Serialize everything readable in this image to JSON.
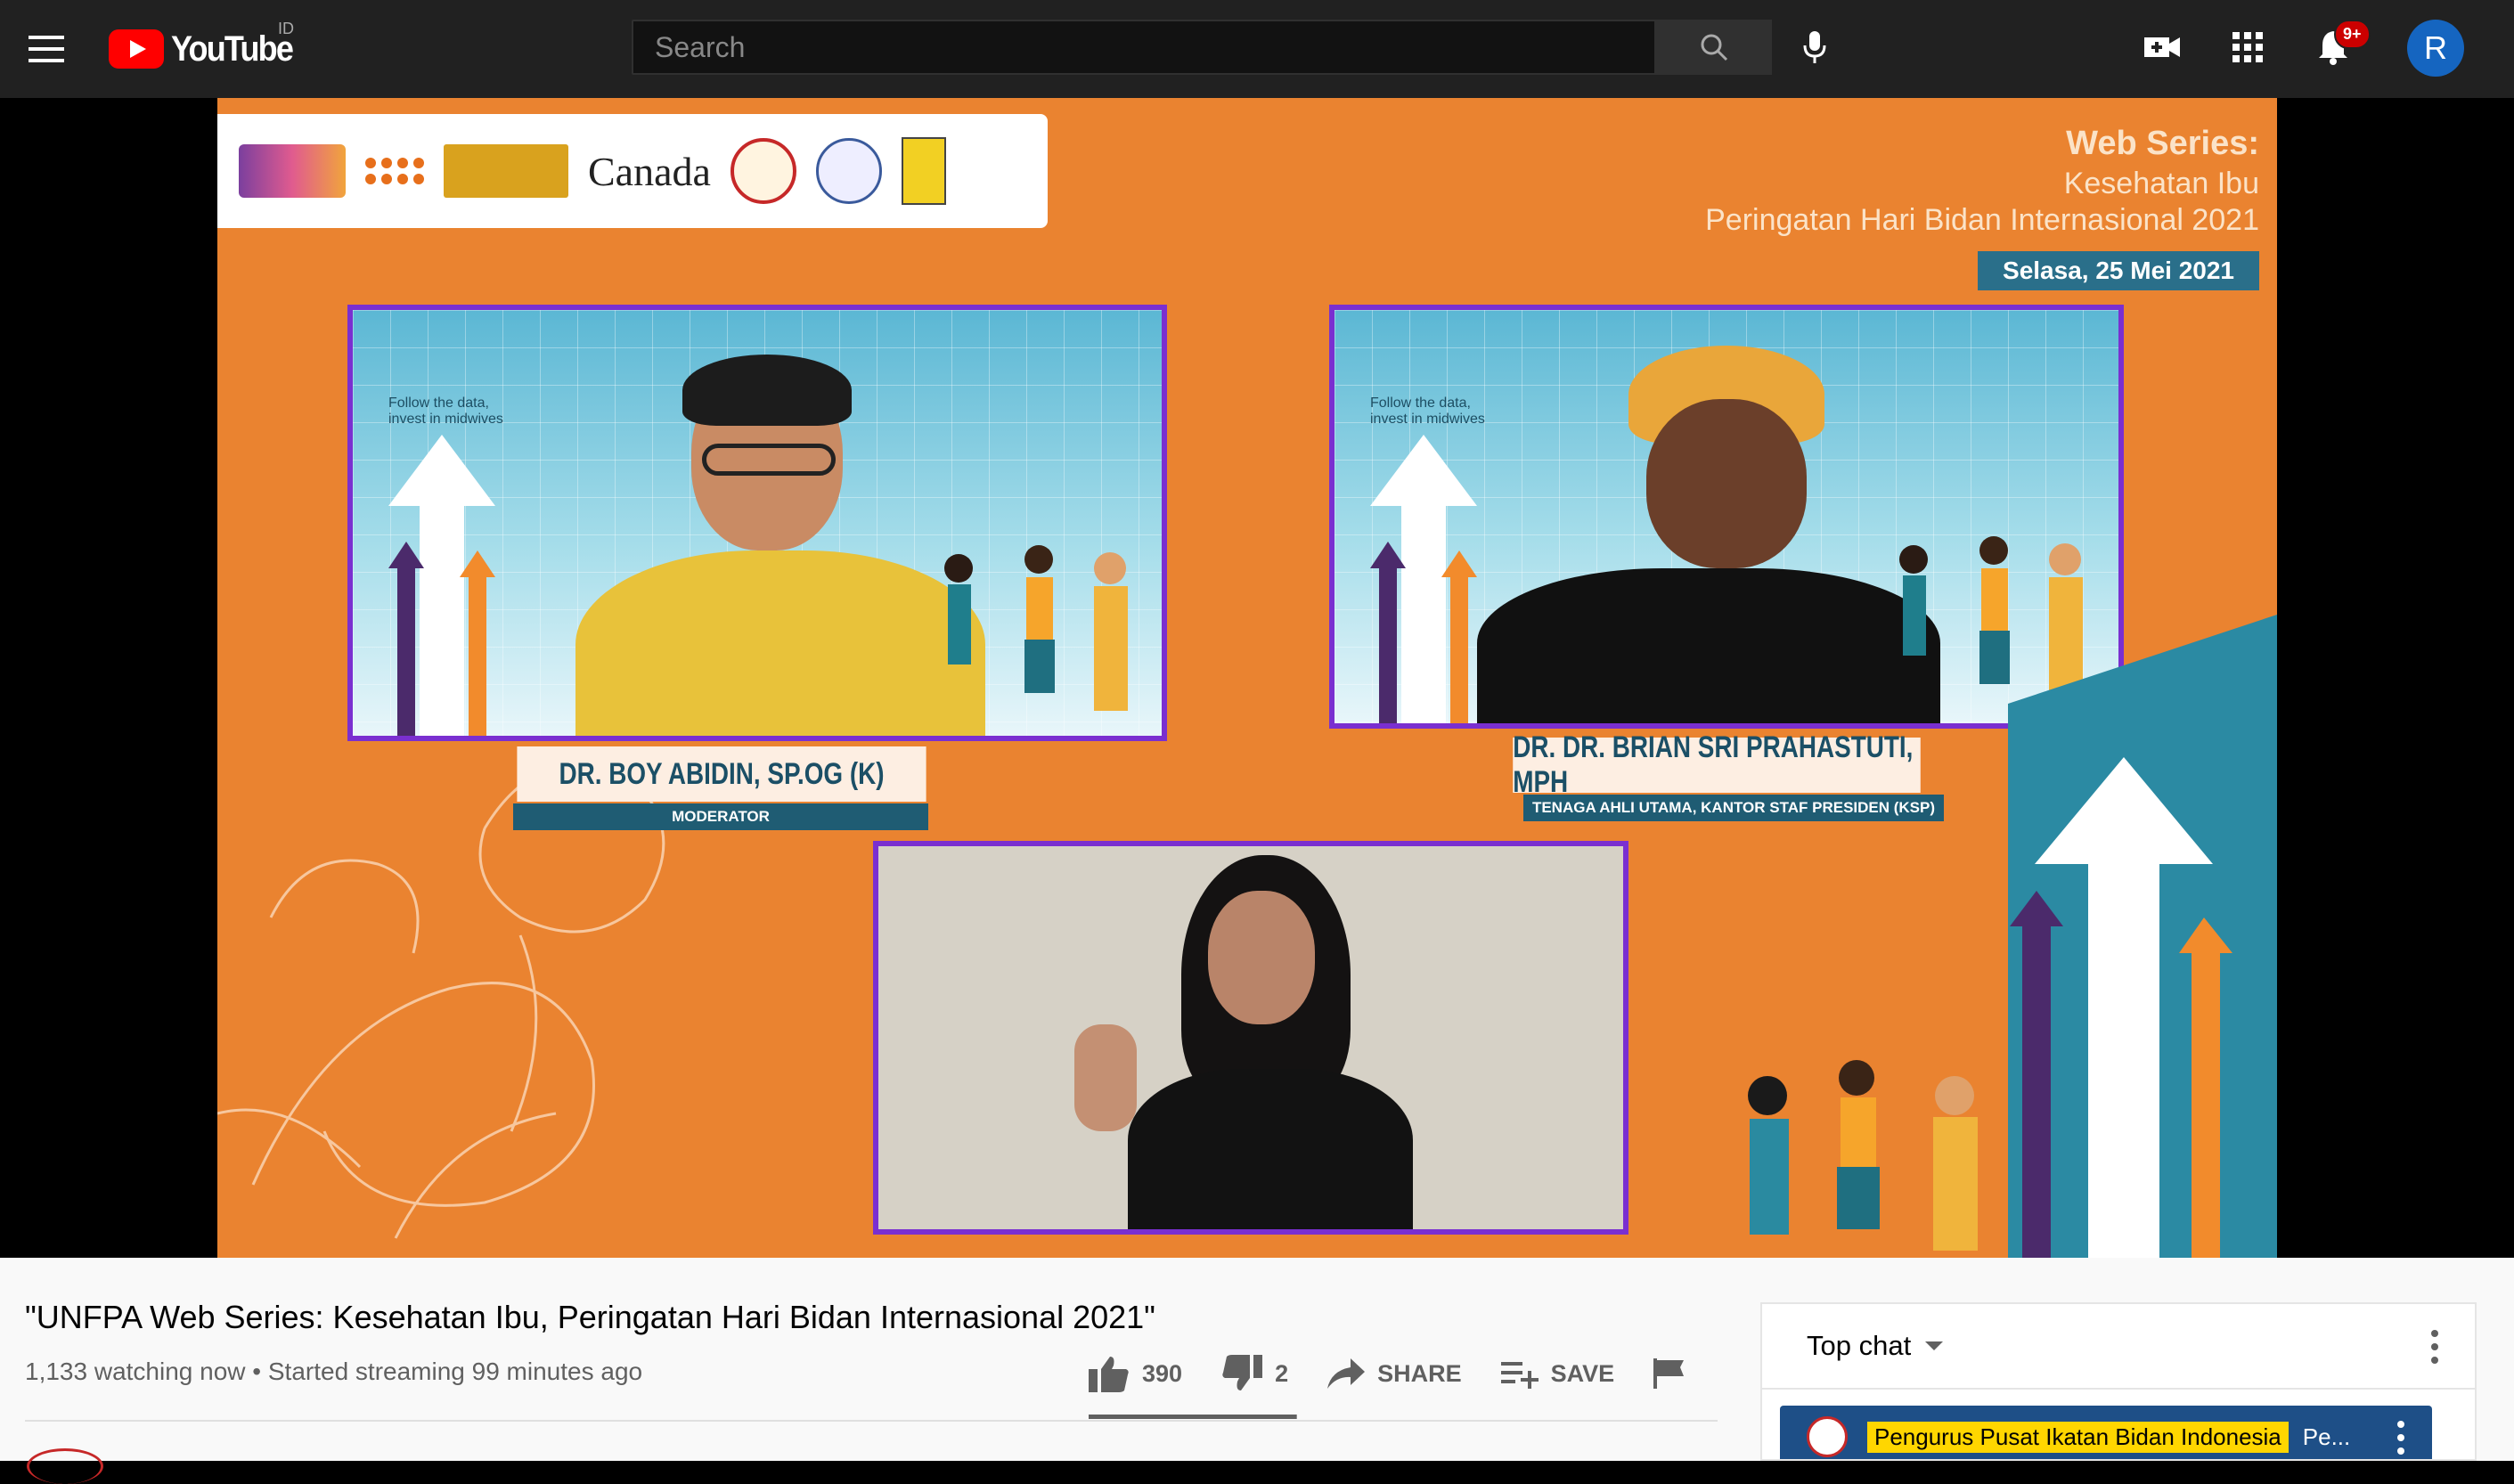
{
  "header": {
    "logo_text": "YouTube",
    "region": "ID",
    "search_placeholder": "Search",
    "notification_count": "9+",
    "avatar_letter": "R"
  },
  "video_frame": {
    "series_title": "Web Series:",
    "series_subtitle": "Kesehatan Ibu",
    "series_event": "Peringatan Hari Bidan Internasional 2021",
    "date": "Selasa, 25 Mei 2021",
    "partner_canada": "Canada",
    "cam_tagline": "Follow the data, invest in midwives",
    "speakers": [
      {
        "name": "DR. BOY ABIDIN, SP.OG (K)",
        "role": "MODERATOR"
      },
      {
        "name": "DR. DR. BRIAN SRI PRAHASTUTI, MPH",
        "role": "TENAGA AHLI UTAMA, KANTOR STAF PRESIDEN (KSP)"
      }
    ]
  },
  "video_info": {
    "title": "\"UNFPA Web Series: Kesehatan Ibu, Peringatan Hari Bidan Internasional 2021\"",
    "meta": "1,133 watching now • Started streaming 99 minutes ago",
    "likes": "390",
    "dislikes": "2",
    "share_label": "SHARE",
    "save_label": "SAVE",
    "like_ratio": 0.995
  },
  "chat": {
    "mode": "Top chat",
    "pinned_author": "Pengurus Pusat Ikatan Bidan Indonesia",
    "pinned_message": "Pe..."
  },
  "colors": {
    "topbar": "#212121",
    "video_orange": "#ea8330",
    "cam_border": "#7a2fd0",
    "brand_red": "#ff0000",
    "avatar_blue": "#1565c0",
    "chat_pinned": "#1e4f87",
    "author_badge": "#ffd600"
  }
}
